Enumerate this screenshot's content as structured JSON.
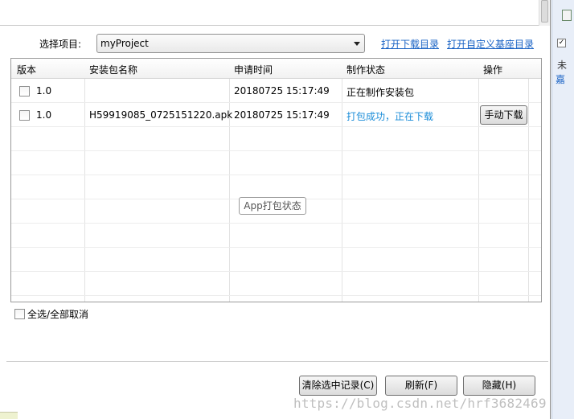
{
  "dialog": {
    "project_label": "选择项目:",
    "project_selected": "myProject",
    "link_download_dir": "打开下载目录",
    "link_custom_base_dir": "打开自定义基座目录"
  },
  "table": {
    "headers": [
      "版本",
      "安装包名称",
      "申请时间",
      "制作状态",
      "操作"
    ],
    "rows": [
      {
        "checked": false,
        "version": "1.0",
        "package_name": "",
        "request_time": "20180725 15:17:49",
        "status": "正在制作安装包",
        "action": ""
      },
      {
        "checked": false,
        "version": "1.0",
        "package_name": "H59919085_0725151220.apk",
        "request_time": "20180725 15:17:49",
        "status": "打包成功，正在下载",
        "action": "手动下载"
      }
    ],
    "overlay_label": "App打包状态"
  },
  "select_all_label": "全选/全部取消",
  "footer": {
    "clear_label": "清除选中记录(C)",
    "refresh_label": "刷新(F)",
    "hide_label": "隐藏(H)"
  },
  "watermark": "https://blog.csdn.net/hrf3682469",
  "background_window": {
    "text1": "未",
    "text2": "嘉"
  },
  "colors": {
    "link": "#1a63c5",
    "success_status": "#1a8cd8"
  }
}
